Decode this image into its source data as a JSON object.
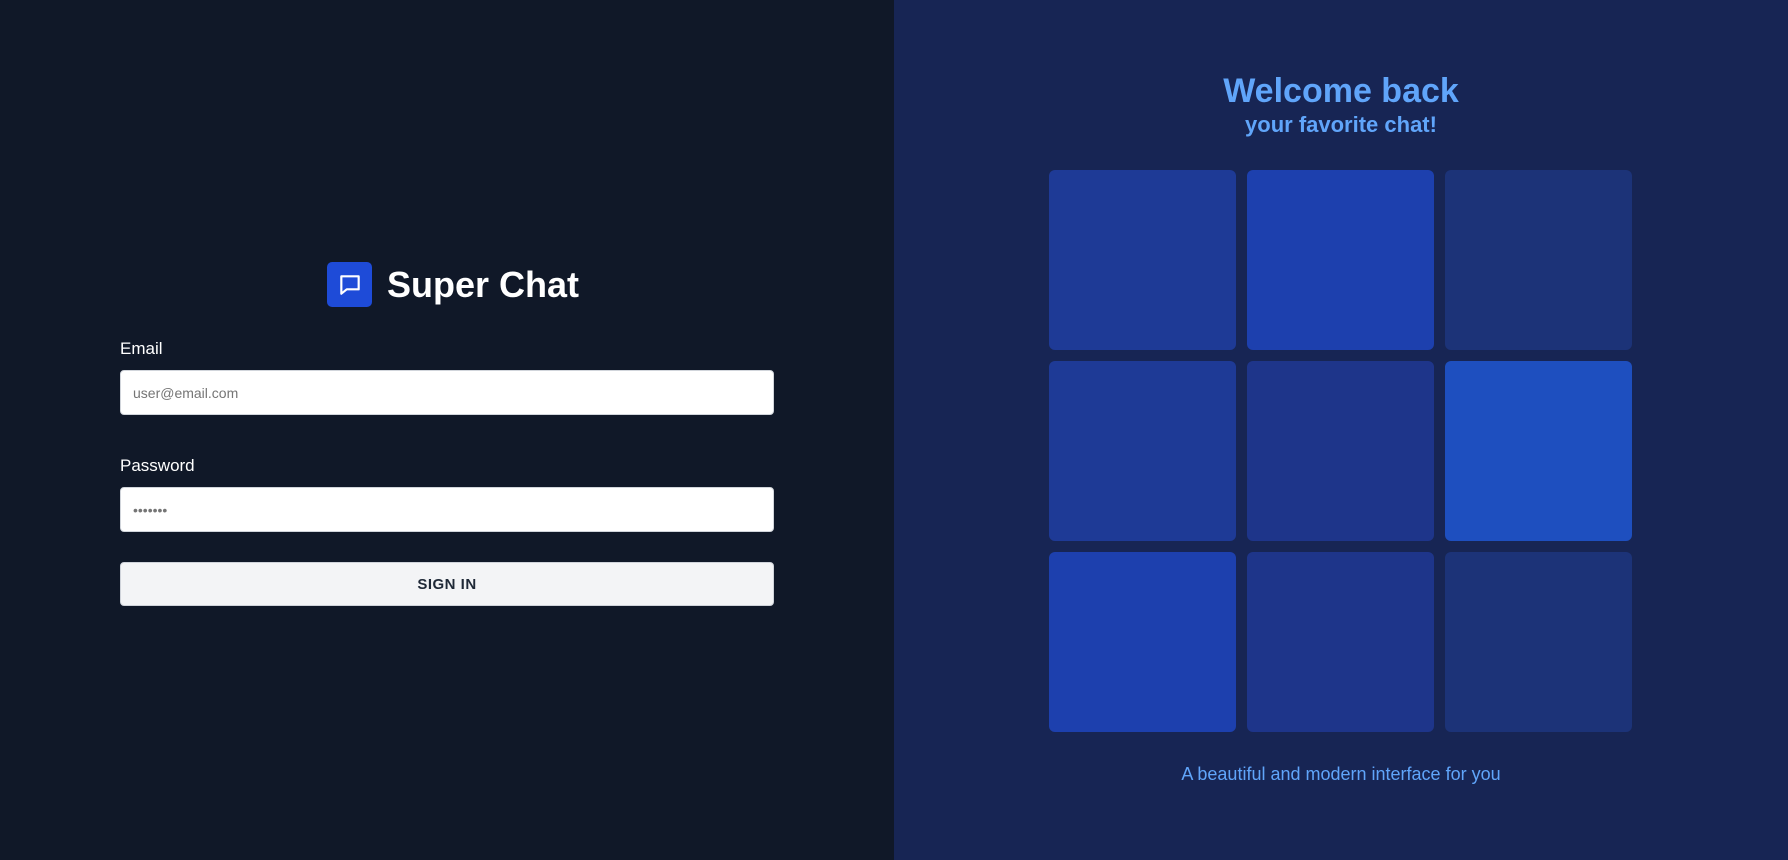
{
  "brand": {
    "title": "Super Chat",
    "icon": "chat-bubble-icon",
    "icon_color": "#1e4bd8"
  },
  "form": {
    "email_label": "Email",
    "email_placeholder": "user@email.com",
    "password_label": "Password",
    "password_placeholder": "•••••••",
    "signin_label": "SIGN IN"
  },
  "welcome": {
    "title": "Welcome back",
    "subtitle": "your favorite chat!",
    "tagline": "A beautiful and modern interface for you"
  },
  "tiles": [
    {
      "color": "#1e3a96"
    },
    {
      "color": "#1d40ae"
    },
    {
      "color": "#1c3378"
    },
    {
      "color": "#1e3a96"
    },
    {
      "color": "#1e358a"
    },
    {
      "color": "#1e4fbf"
    },
    {
      "color": "#1d40ae"
    },
    {
      "color": "#1e358a"
    },
    {
      "color": "#1c3378"
    }
  ],
  "colors": {
    "left_bg": "#101828",
    "right_bg": "#172554",
    "accent": "#60a5fa"
  }
}
